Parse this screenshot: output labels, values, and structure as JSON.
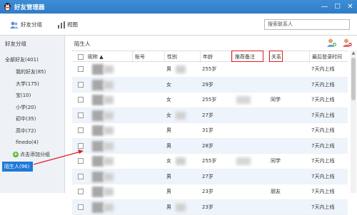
{
  "window": {
    "title": "好友管理器",
    "minimize": "—",
    "maximize": "□",
    "close": "✕"
  },
  "toolbar": {
    "friend_group_label": "好友分组",
    "view_label": "视图",
    "search_placeholder": "搜索联系人"
  },
  "sidebar": {
    "heading": "好友分组",
    "items": [
      {
        "label": "全部好友(401)"
      },
      {
        "label": "我的好友(85)"
      },
      {
        "label": "大学(175)"
      },
      {
        "label": "宝(10)"
      },
      {
        "label": "小学(20)"
      },
      {
        "label": "初中(35)"
      },
      {
        "label": "高中(72)"
      },
      {
        "label": "finedo(4)"
      }
    ],
    "add_group": "点击添加分组",
    "selected": "陌生人(96)"
  },
  "main": {
    "group_title": "陌生人",
    "columns": {
      "nickname": "昵称 ▲",
      "account": "账号",
      "gender": "性别",
      "age": "年龄",
      "remark": "推荐备注",
      "relation": "关系",
      "last_login": "最后登录时间"
    },
    "rows": [
      {
        "gender": "男",
        "age": "255岁",
        "relation": "",
        "last_login": "7天内上线"
      },
      {
        "gender": "女",
        "age": "29岁",
        "relation": "",
        "last_login": "7天内上线"
      },
      {
        "gender": "女",
        "age": "255岁",
        "relation": "同学",
        "last_login": "7天内上线"
      },
      {
        "gender": "女",
        "age": "27岁",
        "relation": "",
        "last_login": "7天内上线"
      },
      {
        "gender": "男",
        "age": "31岁",
        "relation": "",
        "last_login": "7天内上线"
      },
      {
        "gender": "男",
        "age": "28岁",
        "relation": "",
        "last_login": "7天内上线"
      },
      {
        "gender": "女",
        "age": "255岁",
        "relation": "同学",
        "last_login": "7天内上线"
      },
      {
        "gender": "男",
        "age": "27岁",
        "relation": "",
        "last_login": "7天内上线"
      },
      {
        "gender": "男",
        "age": "23岁",
        "relation": "朋友",
        "last_login": "7天内上线"
      },
      {
        "gender": "男",
        "age": "23岁",
        "relation": "",
        "last_login": "7天内上线"
      }
    ]
  },
  "colors": {
    "titlebar": "#2f7cc6",
    "selected": "#1e7ad6",
    "annotation": "#e02020",
    "alt_row": "#eef4fb"
  }
}
